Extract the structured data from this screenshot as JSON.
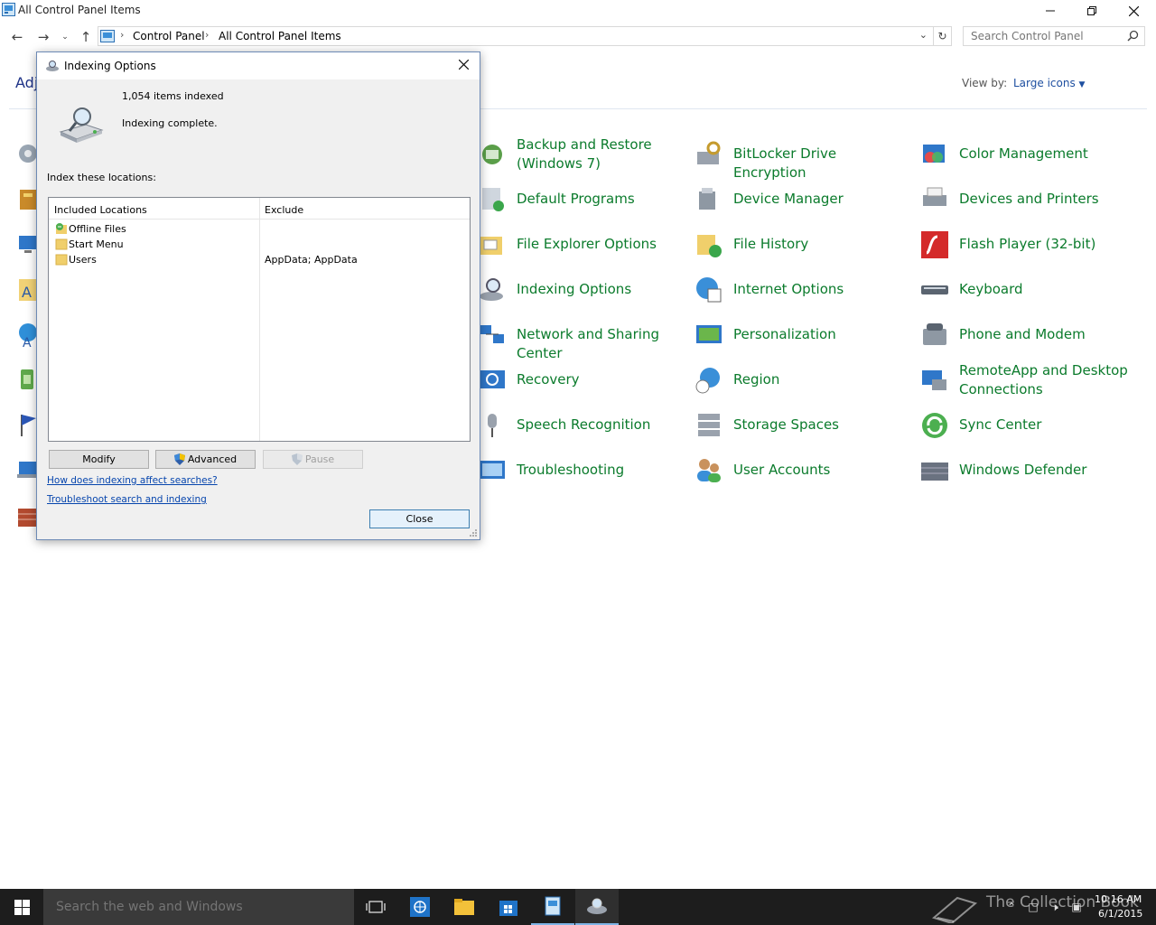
{
  "window": {
    "title": "All Control Panel Items"
  },
  "address_bar": {
    "crumbs": [
      "Control Panel",
      "All Control Panel Items"
    ]
  },
  "search": {
    "placeholder": "Search Control Panel"
  },
  "page": {
    "heading_fragment": "Adj",
    "view_by_label": "View by:",
    "view_by_value": "Large icons"
  },
  "items": [
    {
      "label": "Backup and Restore (Windows 7)",
      "icon": "backup-icon"
    },
    {
      "label": "BitLocker Drive Encryption",
      "icon": "bitlocker-icon"
    },
    {
      "label": "Color Management",
      "icon": "color-management-icon"
    },
    {
      "label": "Default Programs",
      "icon": "default-programs-icon"
    },
    {
      "label": "Device Manager",
      "icon": "device-manager-icon"
    },
    {
      "label": "Devices and Printers",
      "icon": "printer-icon"
    },
    {
      "label": "File Explorer Options",
      "icon": "folder-options-icon"
    },
    {
      "label": "File History",
      "icon": "file-history-icon"
    },
    {
      "label": "Flash Player (32-bit)",
      "icon": "flash-icon"
    },
    {
      "label": "Indexing Options",
      "icon": "indexing-icon"
    },
    {
      "label": "Internet Options",
      "icon": "internet-options-icon"
    },
    {
      "label": "Keyboard",
      "icon": "keyboard-icon"
    },
    {
      "label": "Network and Sharing Center",
      "icon": "network-icon"
    },
    {
      "label": "Personalization",
      "icon": "personalization-icon"
    },
    {
      "label": "Phone and Modem",
      "icon": "phone-icon"
    },
    {
      "label": "Recovery",
      "icon": "recovery-icon"
    },
    {
      "label": "Region",
      "icon": "region-icon"
    },
    {
      "label": "RemoteApp and Desktop Connections",
      "icon": "remoteapp-icon"
    },
    {
      "label": "Speech Recognition",
      "icon": "microphone-icon"
    },
    {
      "label": "Storage Spaces",
      "icon": "storage-icon"
    },
    {
      "label": "Sync Center",
      "icon": "sync-icon"
    },
    {
      "label": "Troubleshooting",
      "icon": "troubleshooting-icon"
    },
    {
      "label": "User Accounts",
      "icon": "users-icon"
    },
    {
      "label": "Windows Defender",
      "icon": "defender-icon"
    }
  ],
  "dialog": {
    "title": "Indexing Options",
    "items_indexed": "1,054 items indexed",
    "status": "Indexing complete.",
    "locations_label": "Index these locations:",
    "columns": {
      "included": "Included Locations",
      "exclude": "Exclude"
    },
    "locations": [
      {
        "name": "Offline Files",
        "exclude": "",
        "icon": "offline-files-icon"
      },
      {
        "name": "Start Menu",
        "exclude": "",
        "icon": "folder-icon"
      },
      {
        "name": "Users",
        "exclude": "AppData; AppData",
        "icon": "folder-icon"
      }
    ],
    "buttons": {
      "modify": "Modify",
      "advanced": "Advanced",
      "pause": "Pause",
      "close": "Close"
    },
    "links": {
      "how": "How does indexing affect searches?",
      "troubleshoot": "Troubleshoot search and indexing"
    }
  },
  "taskbar": {
    "search_placeholder": "Search the web and Windows",
    "watermark": "The Collection Book",
    "time": "10:16 AM",
    "date": "6/1/2015"
  },
  "colors": {
    "item_text": "#0b7b2c",
    "heading": "#1e3287",
    "link": "#0645ad",
    "taskbar": "#1d1d1d"
  }
}
